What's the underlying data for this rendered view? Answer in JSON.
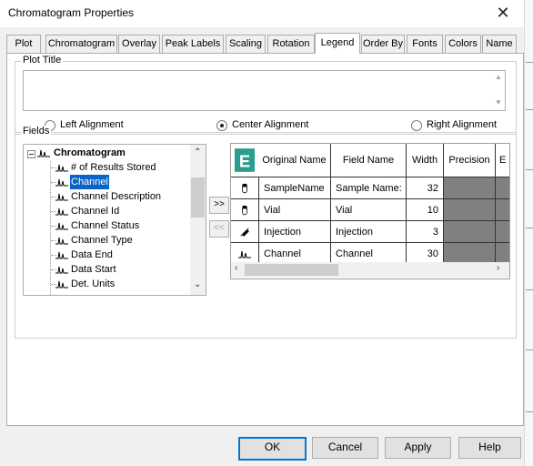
{
  "window": {
    "title": "Chromatogram Properties",
    "close_glyph": "✕"
  },
  "tabs": [
    {
      "label": "Plot"
    },
    {
      "label": "Chromatogram"
    },
    {
      "label": "Overlay"
    },
    {
      "label": "Peak Labels"
    },
    {
      "label": "Scaling"
    },
    {
      "label": "Rotation"
    },
    {
      "label": "Legend",
      "active": true
    },
    {
      "label": "Order By"
    },
    {
      "label": "Fonts"
    },
    {
      "label": "Colors"
    },
    {
      "label": "Name"
    }
  ],
  "plot_title": {
    "group_label": "Plot Title",
    "value": "",
    "alignment": {
      "options": [
        "Left Alignment",
        "Center Alignment",
        "Right Alignment"
      ],
      "selected": "Center Alignment"
    }
  },
  "fields": {
    "group_label": "Fields",
    "tree": {
      "root": "Chromatogram",
      "items": [
        "# of Results Stored",
        "Channel",
        "Channel Description",
        "Channel Id",
        "Channel Status",
        "Channel Type",
        "Data End",
        "Data Start",
        "Det. Units"
      ],
      "selected": "Channel"
    },
    "add_button": ">>",
    "remove_button": "<<",
    "grid": {
      "columns": [
        "Original Name",
        "Field Name",
        "Width",
        "Precision",
        "E"
      ],
      "rows": [
        {
          "icon": "vial-icon",
          "original": "SampleName",
          "field": "Sample Name:",
          "width": "32"
        },
        {
          "icon": "vial-icon",
          "original": "Vial",
          "field": "Vial",
          "width": "10"
        },
        {
          "icon": "syringe-icon",
          "original": "Injection",
          "field": "Injection",
          "width": "3"
        },
        {
          "icon": "chromatogram-icon",
          "original": "Channel",
          "field": "Channel",
          "width": "30"
        }
      ]
    }
  },
  "buttons": {
    "ok": "OK",
    "cancel": "Cancel",
    "apply": "Apply",
    "help": "Help"
  },
  "colors": {
    "selection": "#0a64c8",
    "default_border": "#0078d7",
    "precision_fill": "#808080",
    "grid_logo": "#2a9d8f"
  }
}
